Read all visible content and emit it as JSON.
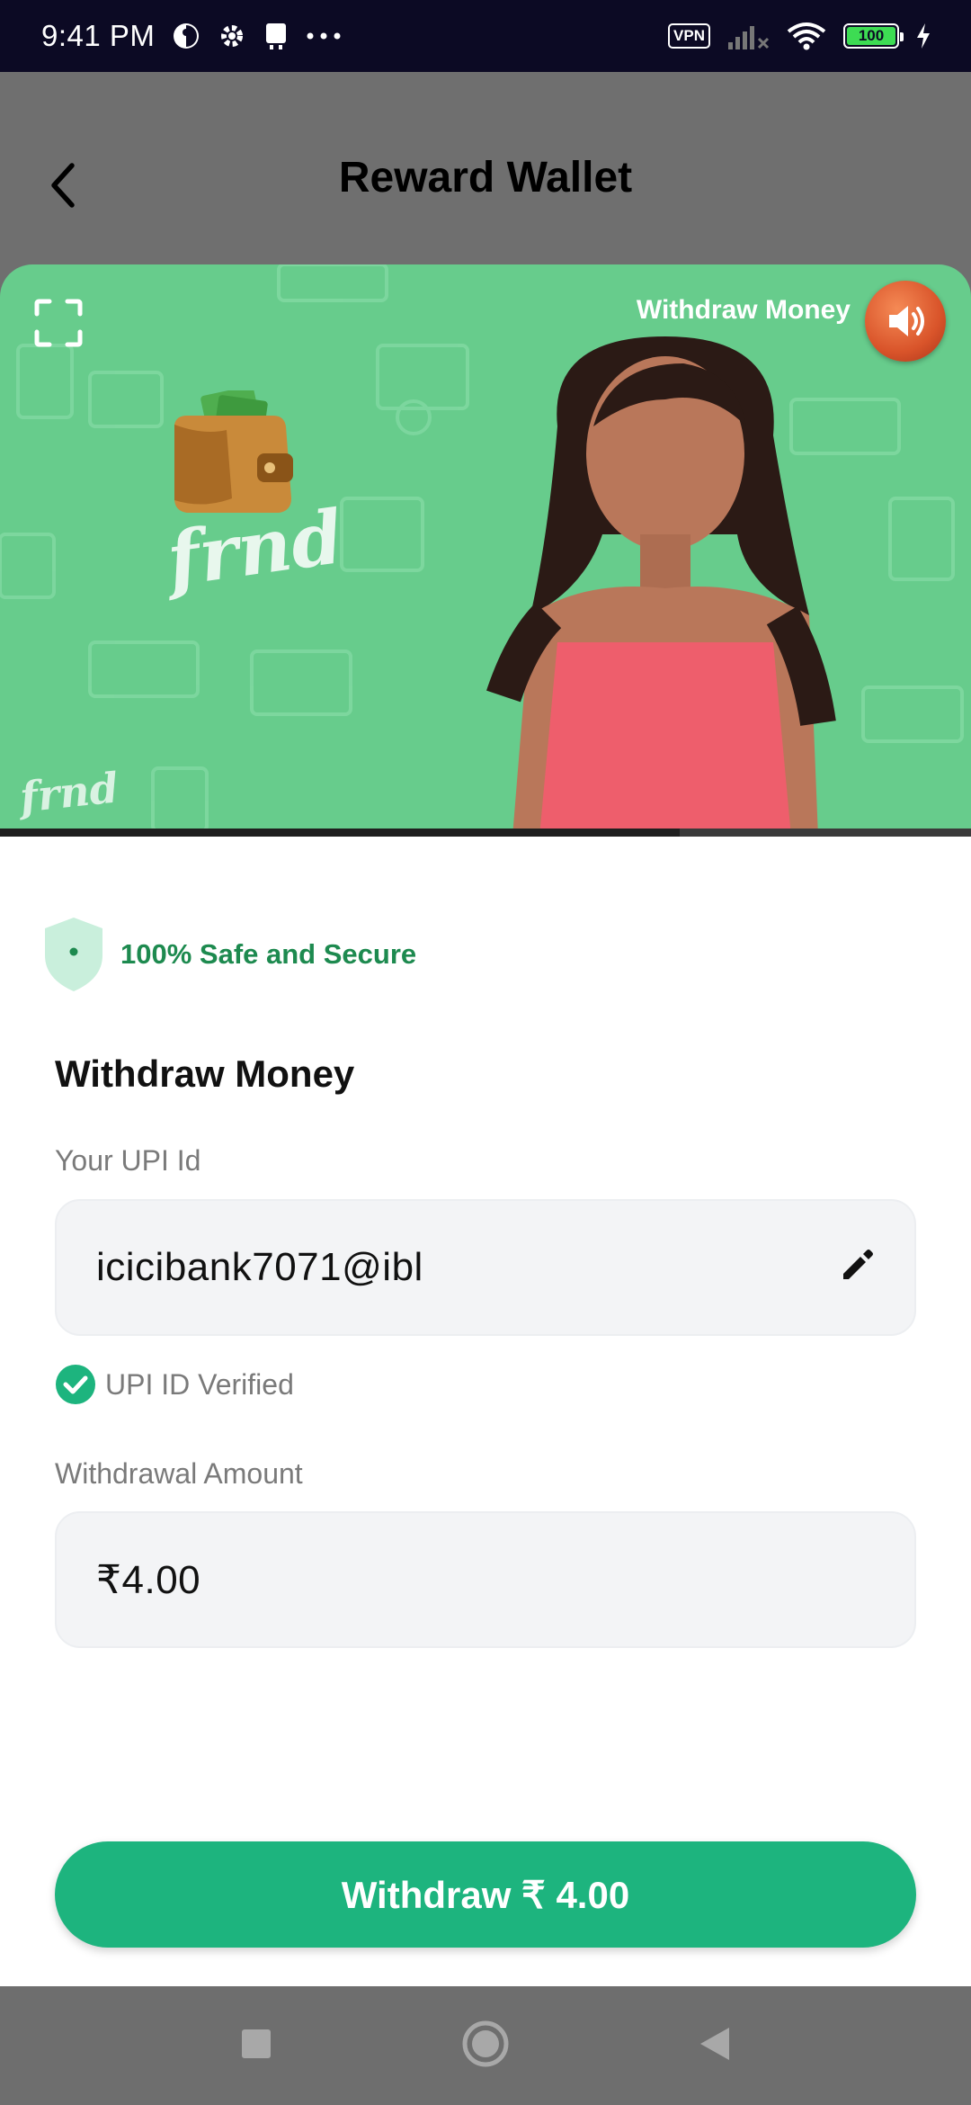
{
  "status_bar": {
    "time": "9:41 PM",
    "vpn": "VPN",
    "battery": "100"
  },
  "header": {
    "title": "Reward Wallet"
  },
  "video": {
    "caption": "Withdraw Money",
    "brand": "frnd",
    "progress": 0.7
  },
  "security": {
    "label": "100% Safe and Secure"
  },
  "form": {
    "title": "Withdraw Money",
    "upi_label": "Your UPI Id",
    "upi_value": "icicibank7071@ibl",
    "verified_label": "UPI ID Verified",
    "amount_label": "Withdrawal Amount",
    "amount_value": "₹4.00"
  },
  "action": {
    "withdraw_label": "Withdraw ₹ 4.00"
  },
  "colors": {
    "accent": "#1db47e",
    "secure_text": "#1d8a4f",
    "video_bg": "#67cc8c",
    "status_bar_bg": "#0c0a24"
  },
  "icons": [
    "settings-icon",
    "sim-icon",
    "signal-icon",
    "wifi-icon",
    "charging-icon",
    "back-icon",
    "fullscreen-icon",
    "sound-icon",
    "shield-icon",
    "edit-icon",
    "check-icon",
    "recent-apps-icon",
    "home-icon",
    "back-nav-icon"
  ]
}
